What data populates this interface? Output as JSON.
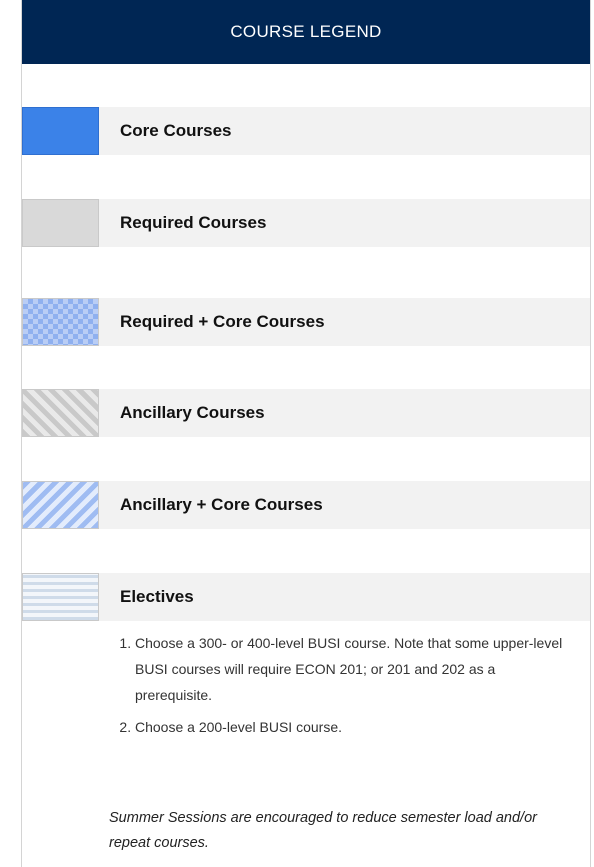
{
  "legend": {
    "title": "COURSE LEGEND",
    "items": [
      {
        "label": "Core Courses",
        "swatch": "core-swatch",
        "color": "#3b82e8"
      },
      {
        "label": "Required Courses",
        "swatch": "required-swatch",
        "color": "#d9d9d9"
      },
      {
        "label": "Required + Core Courses",
        "swatch": "required-core-swatch",
        "color": "#8fb0ef"
      },
      {
        "label": "Ancillary Courses",
        "swatch": "ancillary-swatch",
        "color": "#c9c9c9"
      },
      {
        "label": "Ancillary + Core Courses",
        "swatch": "ancillary-core-swatch",
        "color": "#9fbcf2"
      },
      {
        "label": "Electives",
        "swatch": "electives-swatch",
        "color": "#cfdbe9"
      }
    ],
    "electives_notes": [
      "Choose a 300- or 400-level BUSI course. Note that some upper-level BUSI courses will require ECON 201; or 201 and 202 as a prerequisite.",
      "Choose a 200-level BUSI course."
    ],
    "summer_note": "Summer Sessions are encouraged to reduce semester load and/or repeat courses."
  },
  "colors": {
    "header_bg": "#002654",
    "label_band_bg": "#f2f2f2"
  }
}
